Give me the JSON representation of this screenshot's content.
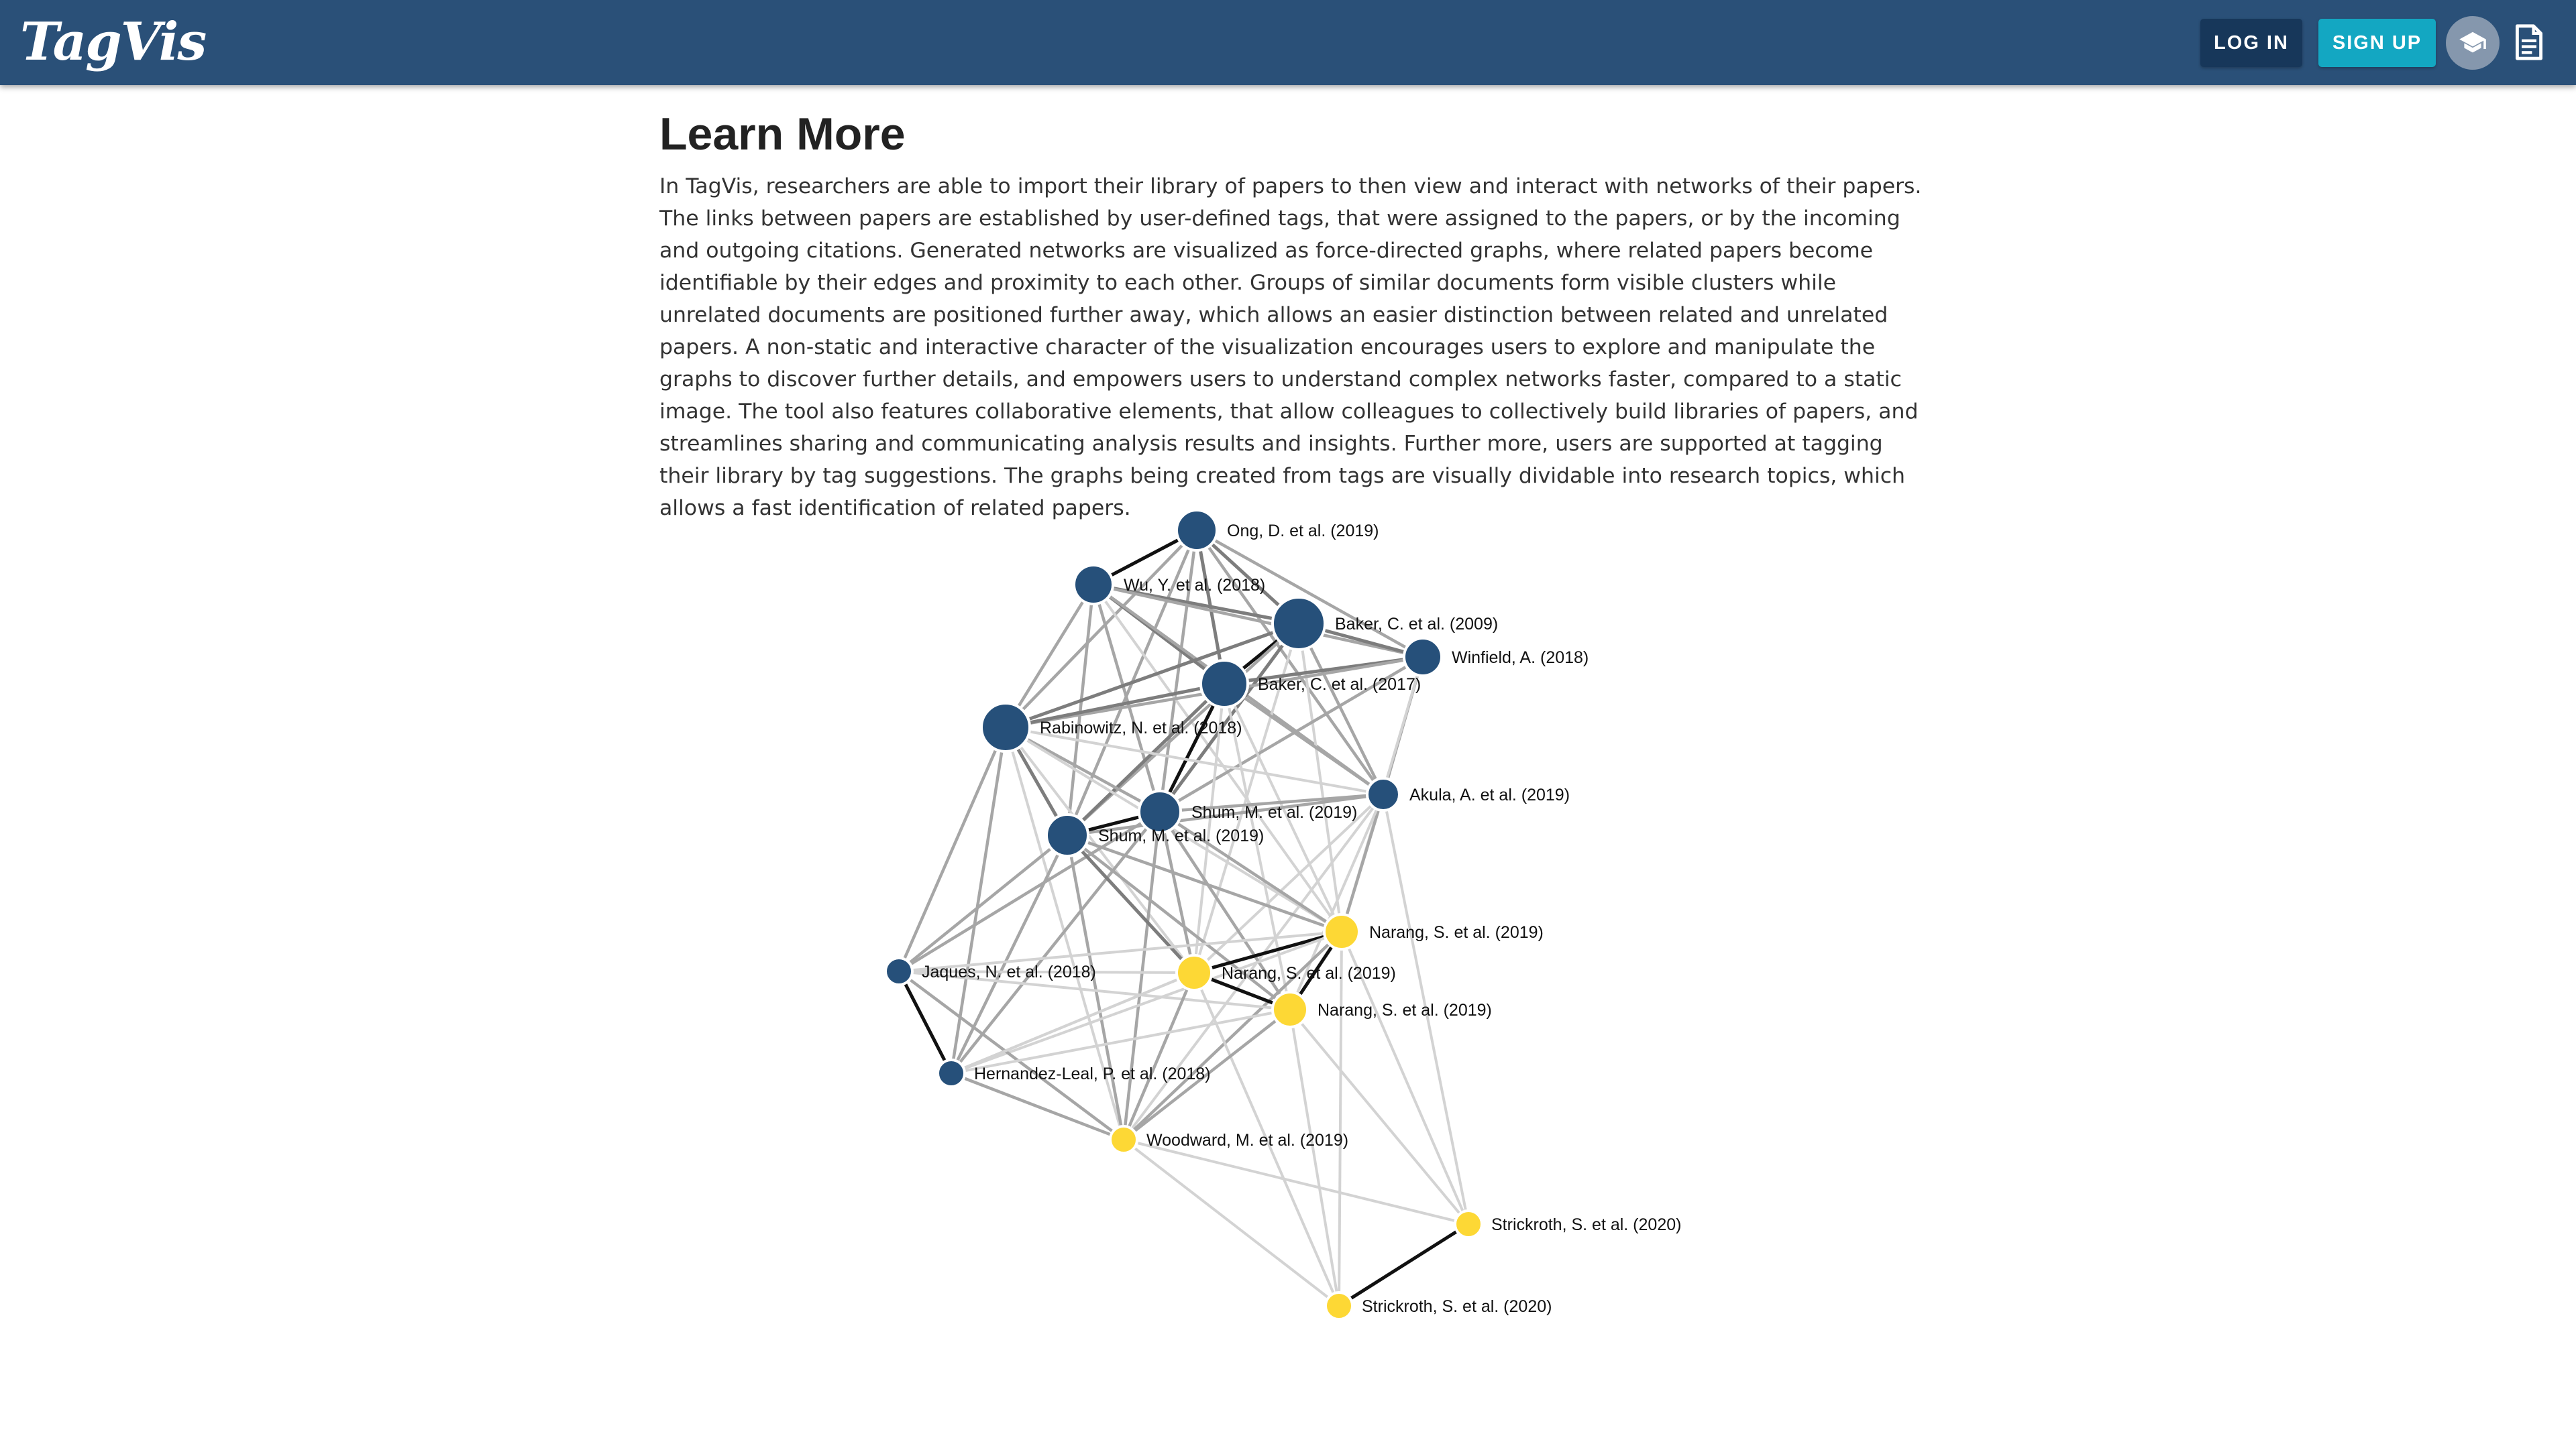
{
  "header": {
    "logo_text": "TagVis",
    "login_label": "LOG IN",
    "signup_label": "SIGN UP",
    "icons": [
      "school-icon",
      "document-icon"
    ],
    "colors": {
      "app_bar": "#2a5078",
      "login": "#17375a",
      "signup": "#13a7c2"
    }
  },
  "main": {
    "title": "Learn More",
    "paragraph": "In TagVis, researchers are able to import their library of papers to then view and interact with networks of their papers. The links between papers are established by user-defined tags, that were assigned to the papers, or by the incoming and outgoing citations. Generated networks are visualized as force-directed graphs, where related papers become identifiable by their edges and proximity to each other. Groups of similar documents form visible clusters while unrelated documents are positioned further away, which allows an easier distinction between related and unrelated papers. A non-static and interactive character of the visualization encourages users to explore and manipulate the graphs to discover further details, and empowers users to understand complex networks faster, compared to a static image. The tool also features collaborative elements, that allow colleagues to collectively build libraries of papers, and streamlines sharing and communicating analysis results and insights. Further more, users are supported at tagging their library by tag suggestions. The graphs being created from tags are visually dividable into research topics, which allows a fast identification of related papers."
  },
  "graph": {
    "colors": {
      "blue": "#26507a",
      "yellow": "#fdd835"
    },
    "nodes": [
      {
        "label": "Ong, D. et al. (2019)",
        "group": "blue"
      },
      {
        "label": "Wu, Y. et al. (2018)",
        "group": "blue"
      },
      {
        "label": "Baker, C. et al. (2009)",
        "group": "blue"
      },
      {
        "label": "Winfield, A. (2018)",
        "group": "blue"
      },
      {
        "label": "Baker, C. et al. (2017)",
        "group": "blue"
      },
      {
        "label": "Rabinowitz, N. et al. (2018)",
        "group": "blue"
      },
      {
        "label": "Akula, A. et al. (2019)",
        "group": "blue"
      },
      {
        "label": "Shum, M. et al. (2019)",
        "group": "blue"
      },
      {
        "label": "Shum, M. et al. (2019)",
        "group": "blue"
      },
      {
        "label": "Narang, S. et al. (2019)",
        "group": "yellow"
      },
      {
        "label": "Jaques, N. et al. (2018)",
        "group": "blue"
      },
      {
        "label": "Narang, S. et al. (2019)",
        "group": "yellow"
      },
      {
        "label": "Narang, S. et al. (2019)",
        "group": "yellow"
      },
      {
        "label": "Hernandez-Leal, P. et al. (2018)",
        "group": "blue"
      },
      {
        "label": "Woodward, M. et al. (2019)",
        "group": "yellow"
      },
      {
        "label": "Strickroth, S. et al. (2020)",
        "group": "yellow"
      },
      {
        "label": "Strickroth, S. et al. (2020)",
        "group": "yellow"
      }
    ]
  }
}
